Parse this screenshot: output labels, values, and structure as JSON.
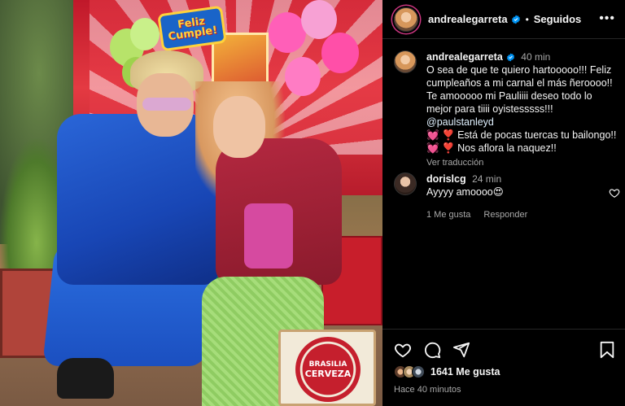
{
  "post": {
    "photo_sign_text": "Feliz Cumple!",
    "photo_can_brand": "BRASILIA",
    "photo_can_sub": "CERVEZA"
  },
  "header": {
    "username": "andrealegarreta",
    "separator": "•",
    "follow_status": "Seguidos",
    "more_icon": "more-horizontal-icon"
  },
  "caption": {
    "username": "andrealegarreta",
    "time": "40 min",
    "text_line1": "O sea de que te quiero hartooooo!!! Feliz cumpleaños a mi carnal el más ñeroooo!! Te amooooo mi Pauliiii deseo todo lo mejor para tiiii oyistesssss!!! ",
    "mention": "@paulstanleyd",
    "text_line2": "💓 ❣️ Está de pocas tuercas tu bailongo!!",
    "text_line3": "💓 ❣️ Nos aflora la naquez!!",
    "see_translation": "Ver traducción"
  },
  "comment": {
    "username": "dorislcg",
    "time": "24 min",
    "text": "Ayyyy amoooo😍",
    "likes": "1 Me gusta",
    "reply": "Responder"
  },
  "actions": {
    "likes_count": "1641 Me gusta",
    "posted_ago": "Hace 40 minutos"
  },
  "colors": {
    "background": "#000000",
    "text": "#f5f5f5",
    "muted": "#a8a8a8",
    "verified": "#0095f6",
    "divider": "#262626"
  }
}
